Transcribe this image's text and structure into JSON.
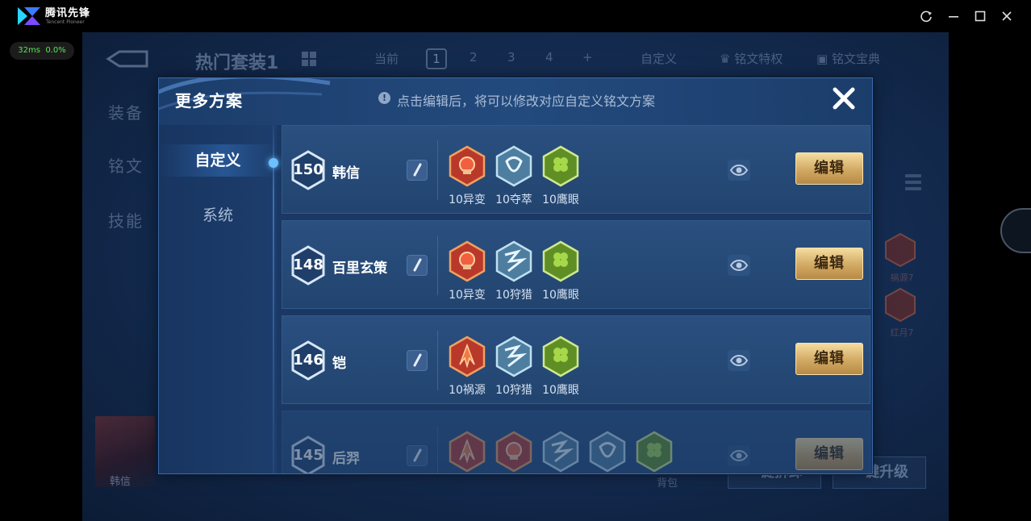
{
  "emulator": {
    "brand": "腾讯先锋",
    "brand_sub": "Tencent Pioneer",
    "ping": "32ms",
    "loss": "0.0%"
  },
  "background": {
    "set_title": "热门套装1",
    "current_label": "当前",
    "pages": [
      "1",
      "2",
      "3",
      "4",
      "+"
    ],
    "custom_label": "自定义",
    "rune_traits": "铭文特权",
    "rune_book": "铭文宝典",
    "side_items": [
      "装备",
      "铭文",
      "技能"
    ],
    "hero_name": "韩信",
    "bag_label": "背包",
    "btn_unload": "一键拆卸",
    "btn_upgrade": "一键升级",
    "rune_labels": [
      "祸源7",
      "红月7"
    ]
  },
  "modal": {
    "title": "更多方案",
    "hint": "点击编辑后，将可以修改对应自定义铭文方案",
    "tabs": [
      "自定义",
      "系统"
    ],
    "edit_label": "编辑",
    "plans": [
      {
        "level": "150",
        "name": "韩信",
        "runes": [
          {
            "label": "10异变",
            "kind": "red-shield"
          },
          {
            "label": "10夺萃",
            "kind": "blue-knot"
          },
          {
            "label": "10鹰眼",
            "kind": "green-clover"
          }
        ]
      },
      {
        "level": "148",
        "name": "百里玄策",
        "runes": [
          {
            "label": "10异变",
            "kind": "red-shield"
          },
          {
            "label": "10狩猎",
            "kind": "blue-bolt"
          },
          {
            "label": "10鹰眼",
            "kind": "green-clover"
          }
        ]
      },
      {
        "level": "146",
        "name": "铠",
        "runes": [
          {
            "label": "10祸源",
            "kind": "red-flame"
          },
          {
            "label": "10狩猎",
            "kind": "blue-bolt"
          },
          {
            "label": "10鹰眼",
            "kind": "green-clover"
          }
        ]
      },
      {
        "level": "145",
        "name": "后羿",
        "runes": [
          {
            "label": "",
            "kind": "red-flame"
          },
          {
            "label": "",
            "kind": "red-shield"
          },
          {
            "label": "",
            "kind": "blue-bolt"
          },
          {
            "label": "",
            "kind": "blue-knot"
          },
          {
            "label": "",
            "kind": "green-clover"
          }
        ]
      }
    ]
  },
  "colors": {
    "accent_gold": "#d1a963",
    "modal_bg": "#1a3863",
    "rune_red": "#c8452a",
    "rune_blue": "#7fb6d8",
    "rune_green": "#8bbf3a"
  }
}
